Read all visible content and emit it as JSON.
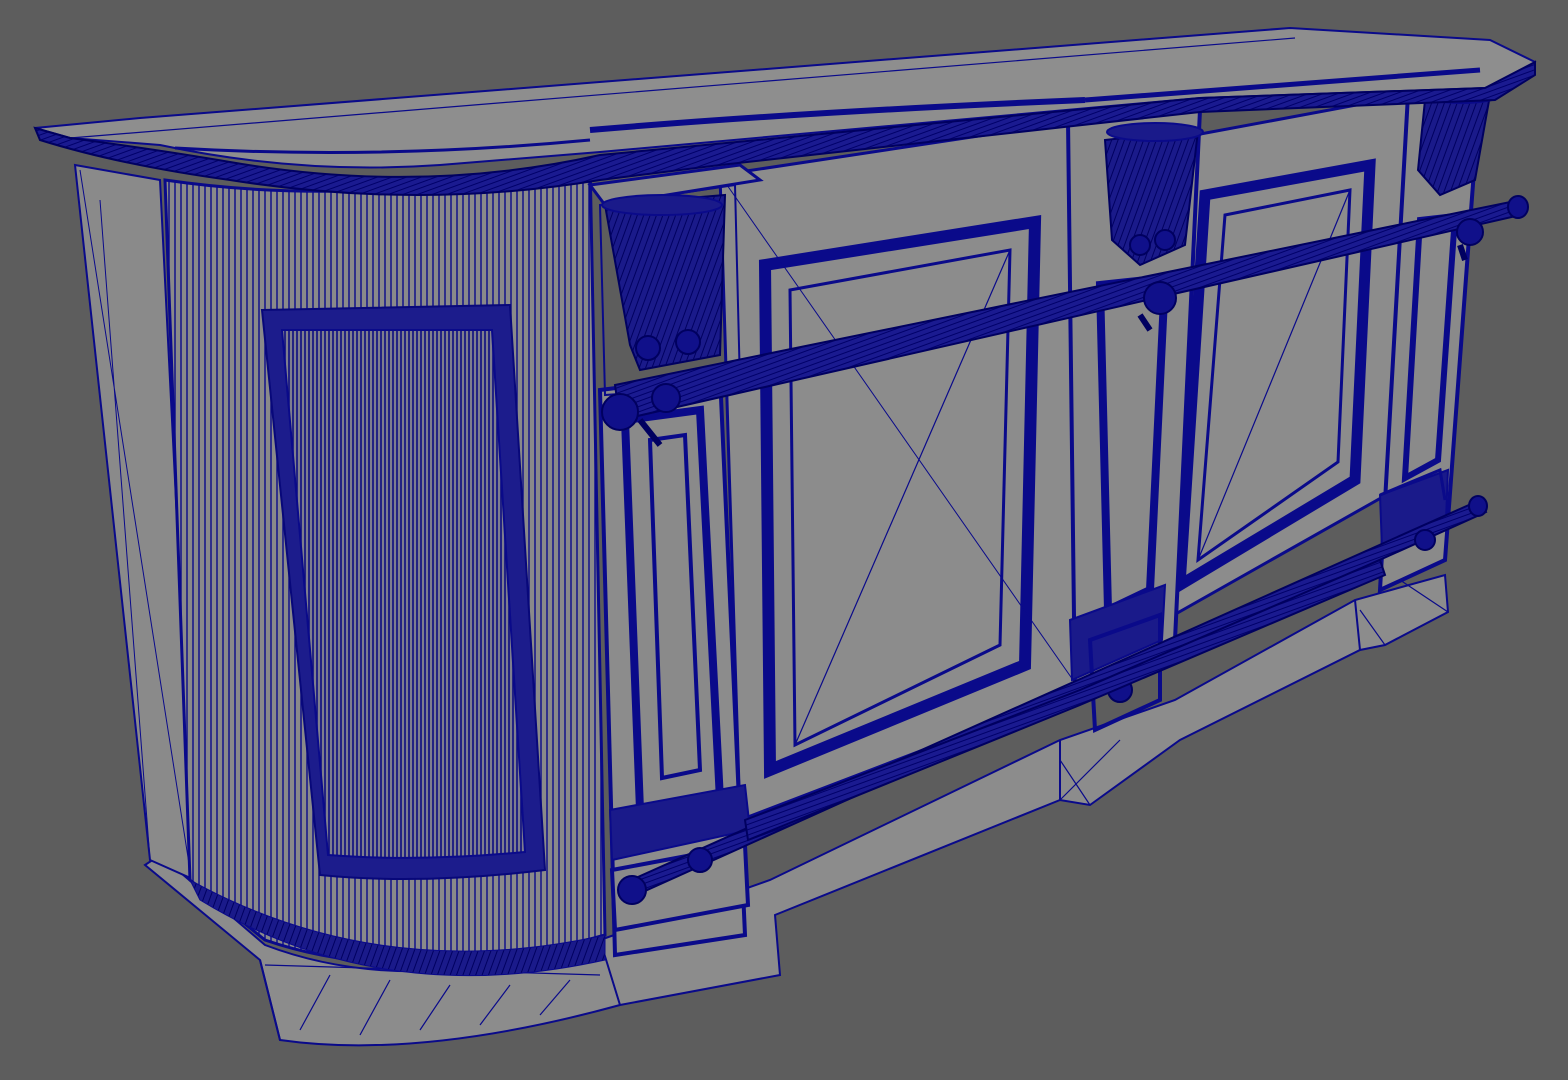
{
  "viewport": {
    "background": "#5d5d5d",
    "shaded_face": "#8a8a8a",
    "wire_color": "#0a0a8a",
    "dense_wire_color": "#0c0c80"
  },
  "model": {
    "name": "bar-counter-wireframe",
    "view": "perspective",
    "display_mode": "wireframe-on-shaded",
    "parts": [
      "countertop",
      "curved-end-panel",
      "front-panel-left",
      "front-panel-right",
      "carved-corbel-left",
      "carved-corbel-middle",
      "carved-corbel-right",
      "pilaster-left",
      "pilaster-middle",
      "pilaster-right",
      "armrest-rail",
      "foot-rail",
      "plinth-base"
    ]
  }
}
